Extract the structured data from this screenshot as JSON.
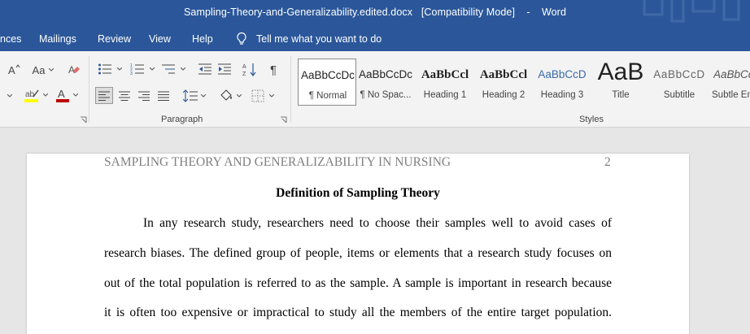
{
  "window": {
    "filename": "Sampling-Theory-and-Generalizability.edited.docx",
    "mode": "[Compatibility Mode]",
    "separator": "-",
    "app": "Word"
  },
  "tabs": [
    "nces",
    "Mailings",
    "Review",
    "View",
    "Help"
  ],
  "tell_me": "Tell me what you want to do",
  "ribbon": {
    "font_group": {
      "font_size_label": "A",
      "change_case_label": "Aa"
    },
    "paragraph_group": {
      "label": "Paragraph"
    },
    "styles_group": {
      "label": "Styles",
      "items": [
        {
          "preview": "AaBbCcDc",
          "name": "¶ Normal"
        },
        {
          "preview": "AaBbCcDc",
          "name": "¶ No Spac..."
        },
        {
          "preview": "AaBbCcl",
          "name": "Heading 1"
        },
        {
          "preview": "AaBbCcl",
          "name": "Heading 2"
        },
        {
          "preview": "AaBbCcD",
          "name": "Heading 3"
        },
        {
          "preview": "AaB",
          "name": "Title"
        },
        {
          "preview": "AaBbCcD",
          "name": "Subtitle"
        },
        {
          "preview": "AaBbCc",
          "name": "Subtle Em"
        }
      ]
    }
  },
  "colors": {
    "accent": "#2b579a",
    "highlight": "#ffff00",
    "font_color": "#c00000"
  },
  "document": {
    "header": "SAMPLING THEORY AND GENERALIZABILITY IN NURSING",
    "page_number": "2",
    "heading": "Definition of Sampling Theory",
    "lines": [
      "In any research study, researchers need to choose their samples well to avoid cases of",
      "research biases. The defined group of people, items or elements that a research study focuses on",
      "out of the total population is referred to as the sample. A sample is important in research because",
      "it is often too expensive or impractical to study all the members of the entire target population."
    ]
  }
}
